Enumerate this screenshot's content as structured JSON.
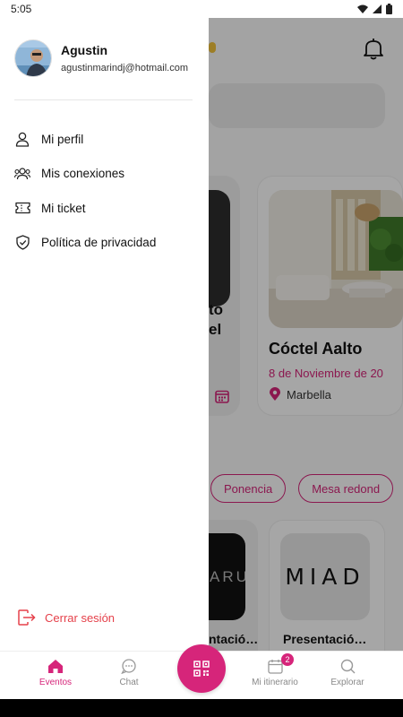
{
  "status_bar": {
    "time": "5:05"
  },
  "drawer": {
    "user": {
      "name": "Agustin",
      "email": "agustinmarindj@hotmail.com"
    },
    "menu": [
      {
        "label": "Mi perfil",
        "icon": "user-icon"
      },
      {
        "label": "Mis conexiones",
        "icon": "connections-icon"
      },
      {
        "label": "Mi ticket",
        "icon": "ticket-icon"
      },
      {
        "label": "Política de privacidad",
        "icon": "shield-icon"
      }
    ],
    "logout_label": "Cerrar sesión"
  },
  "background": {
    "event_card_partial": {
      "line1": "to",
      "line2": "el"
    },
    "event_card": {
      "title": "Cóctel Aalto",
      "date": "8 de Noviembre de 20",
      "location": "Marbella"
    },
    "chips": [
      "Ponencia",
      "Mesa redond"
    ],
    "bottom_cards": [
      {
        "logo_text": "ARU",
        "title": "ntació…"
      },
      {
        "logo_text": "MIAD",
        "title": "Presentació…"
      }
    ]
  },
  "bottom_nav": {
    "items": [
      {
        "label": "Eventos",
        "active": true
      },
      {
        "label": "Chat",
        "active": false
      },
      {
        "label": "Mi itinerario",
        "active": false,
        "badge": "2"
      },
      {
        "label": "Explorar",
        "active": false
      }
    ]
  },
  "colors": {
    "accent": "#d6257a",
    "logout": "#e5404a"
  }
}
